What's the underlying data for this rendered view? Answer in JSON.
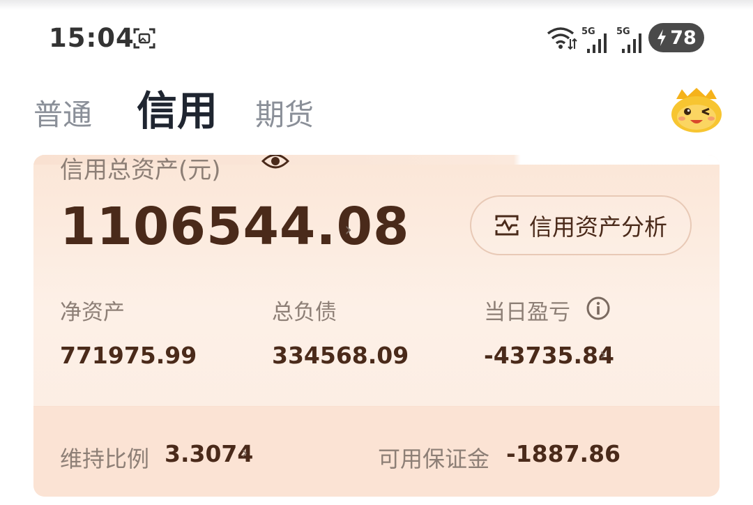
{
  "status_bar": {
    "time": "15:04",
    "signal_1": "5G",
    "signal_2": "5G",
    "battery": "78",
    "icons": [
      "screenshot-icon",
      "wifi-icon",
      "signal-icon",
      "signal-icon",
      "charging-icon"
    ]
  },
  "tabs": [
    {
      "label": "普通",
      "active": false
    },
    {
      "label": "信用",
      "active": true
    },
    {
      "label": "期货",
      "active": false
    }
  ],
  "card": {
    "title": "信用总资产(元)",
    "total_assets": "1106544.08",
    "analysis_button": "信用资产分析",
    "metrics": [
      {
        "label": "净资产",
        "value": "771975.99"
      },
      {
        "label": "总负债",
        "value": "334568.09"
      },
      {
        "label": "当日盈亏",
        "value": "-43735.84"
      }
    ],
    "maintenance_ratio_label": "维持比例",
    "maintenance_ratio": "3.3074",
    "available_margin_label": "可用保证金",
    "available_margin": "-1887.86"
  },
  "colors": {
    "card_bg": "#fbe6d7",
    "value_text": "#4a2a1a",
    "label_text": "#8d7f76"
  }
}
